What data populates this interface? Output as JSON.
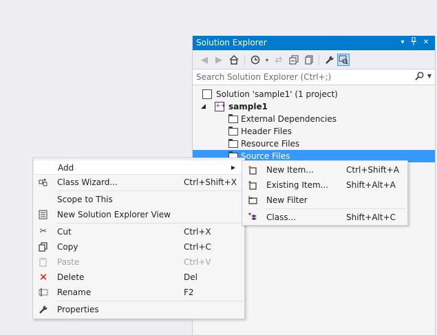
{
  "solution_explorer": {
    "title": "Solution Explorer",
    "title_buttons": {
      "dropdown": "▾",
      "pin": "📌",
      "close": "✕"
    },
    "toolbar": [
      "back-icon",
      "forward-icon",
      "home-icon",
      "history-icon",
      "sync-icon",
      "collapse-all-icon",
      "show-all-files-icon",
      "properties-icon",
      "preview-icon"
    ],
    "search_placeholder": "Search Solution Explorer (Ctrl+;)",
    "tree": {
      "solution": "Solution 'sample1' (1 project)",
      "project": "sample1",
      "folders": [
        "External Dependencies",
        "Header Files",
        "Resource Files",
        "Source Files"
      ],
      "selected": "Source Files"
    }
  },
  "context_menu": {
    "items": [
      {
        "label": "Add",
        "submenu": true
      },
      {
        "label": "Class Wizard...",
        "shortcut": "Ctrl+Shift+X",
        "icon": "class-wizard-icon"
      },
      {
        "label": "Scope to This"
      },
      {
        "label": "New Solution Explorer View",
        "icon": "new-view-icon"
      },
      {
        "label": "Cut",
        "shortcut": "Ctrl+X",
        "icon": "scissors-icon"
      },
      {
        "label": "Copy",
        "shortcut": "Ctrl+C",
        "icon": "copy-icon"
      },
      {
        "label": "Paste",
        "shortcut": "Ctrl+V",
        "icon": "paste-icon",
        "disabled": true
      },
      {
        "label": "Delete",
        "shortcut": "Del",
        "icon": "delete-icon"
      },
      {
        "label": "Rename",
        "shortcut": "F2",
        "icon": "rename-icon"
      },
      {
        "label": "Properties",
        "icon": "wrench-icon"
      }
    ]
  },
  "add_submenu": {
    "items": [
      {
        "label": "New Item...",
        "shortcut": "Ctrl+Shift+A",
        "icon": "new-item-icon"
      },
      {
        "label": "Existing Item...",
        "shortcut": "Shift+Alt+A",
        "icon": "existing-item-icon"
      },
      {
        "label": "New Filter",
        "icon": "new-filter-icon"
      },
      {
        "label": "Class...",
        "shortcut": "Shift+Alt+C",
        "icon": "class-icon"
      }
    ]
  },
  "colors": {
    "title_bar": "#007acc",
    "selection": "#3399ff",
    "menu_bg": "#f6f6f6",
    "delete_red": "#e51400"
  }
}
